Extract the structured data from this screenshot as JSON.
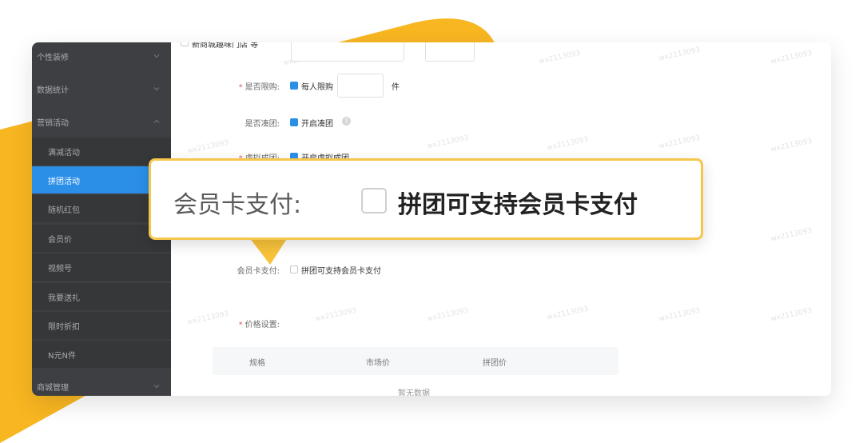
{
  "colors": {
    "accent_yellow": "#f8b621",
    "sidebar_bg": "#3d3f42",
    "active_blue": "#2b8fe8",
    "callout_border": "#f6c64c"
  },
  "sidebar": {
    "items": [
      {
        "label": "个性装修",
        "type": "parent",
        "icon": "chevron-down-icon"
      },
      {
        "label": "数据统计",
        "type": "parent",
        "icon": "chevron-down-icon"
      },
      {
        "label": "营销活动",
        "type": "parent",
        "icon": "chevron-up-icon"
      },
      {
        "label": "满减活动",
        "type": "child"
      },
      {
        "label": "拼团活动",
        "type": "child",
        "active": true
      },
      {
        "label": "随机红包",
        "type": "child"
      },
      {
        "label": "会员价",
        "type": "child"
      },
      {
        "label": "视频号",
        "type": "child"
      },
      {
        "label": "我要送礼",
        "type": "child"
      },
      {
        "label": "限时折扣",
        "type": "child"
      },
      {
        "label": "N元N件",
        "type": "child"
      },
      {
        "label": "商城管理",
        "type": "parent",
        "icon": "chevron-down-icon"
      }
    ]
  },
  "form": {
    "top_partial_label": "新商城趣味门店 等",
    "purchase_limit": {
      "label": "是否限购:",
      "checkbox_label": "每人限购",
      "unit": "件",
      "value": ""
    },
    "group_buying": {
      "label": "是否凑团:",
      "checkbox_label": "开启凑团"
    },
    "virtual_group": {
      "label": "虚拟成团:",
      "checkbox_label": "开启虚拟成团"
    },
    "member_card": {
      "label": "会员卡支付:",
      "checkbox_label": "拼团可支持会员卡支付"
    },
    "price_setting": {
      "label": "价格设置:",
      "columns": [
        "规格",
        "市场价",
        "拼团价"
      ],
      "empty_text": "暂无数据"
    }
  },
  "callout": {
    "label": "会员卡支付:",
    "checkbox_label": "拼团可支持会员卡支付"
  },
  "watermark_text": "wx2113093"
}
